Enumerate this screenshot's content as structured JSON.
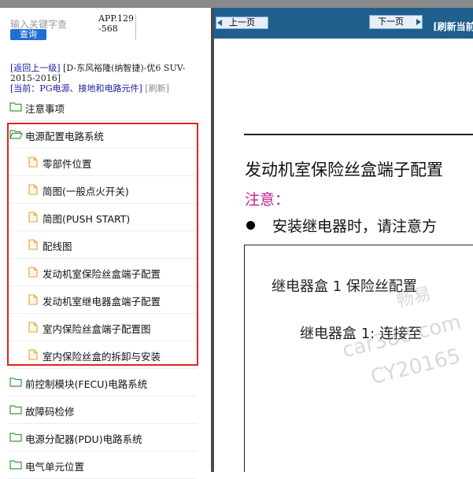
{
  "search": {
    "placeholder": "输入关键字查",
    "button_label": "查询"
  },
  "app_code": "APP.129-568",
  "nav": {
    "back_link": "[返回上一级]",
    "vehicle": "[D-东风裕隆(纳智捷)-优6 SUV-2015-2016]",
    "current_link": "[当前：PG电源、接地和电路元件]",
    "refresh": "[刷新]"
  },
  "tree": {
    "items": [
      {
        "type": "folder",
        "label": "注意事项",
        "open": false
      },
      {
        "type": "folder",
        "label": "电源配置电路系统",
        "open": true
      },
      {
        "type": "page",
        "label": "零部件位置"
      },
      {
        "type": "page",
        "label": "简图(一般点火开关)"
      },
      {
        "type": "page",
        "label": "简图(PUSH START)"
      },
      {
        "type": "page",
        "label": "配线图"
      },
      {
        "type": "page",
        "label": "发动机室保险丝盒端子配置"
      },
      {
        "type": "page",
        "label": "发动机室继电器盒端子配置"
      },
      {
        "type": "page",
        "label": "室内保险丝盒端子配置图"
      },
      {
        "type": "page",
        "label": "室内保险丝盒的拆卸与安装"
      },
      {
        "type": "folder",
        "label": "前控制模块(FECU)电路系统",
        "open": false
      },
      {
        "type": "folder",
        "label": "故障码检修",
        "open": false
      },
      {
        "type": "folder",
        "label": "电源分配器(PDU)电路系统",
        "open": false
      },
      {
        "type": "folder",
        "label": "电气单元位置",
        "open": false
      }
    ]
  },
  "toolbar": {
    "prev_label": "上一页",
    "next_label": "下一页",
    "refresh_label": "[刷新当前"
  },
  "doc": {
    "title": "发动机室保险丝盒端子配置",
    "note_label": "注意：",
    "bullet_text": "安装继电器时，请注意方",
    "box_title": "继电器盒 1 保险丝配置",
    "box_sub": "继电器盒 1: 连接至"
  },
  "watermark": {
    "line1": "畅易",
    "line2": "car388.com",
    "line3": "CY20165"
  },
  "colors": {
    "toolbar": "#1e5f8e",
    "highlight": "#e02525",
    "note": "#c0228e",
    "link": "#1a1aa6",
    "search_button": "#1e6fd0"
  }
}
